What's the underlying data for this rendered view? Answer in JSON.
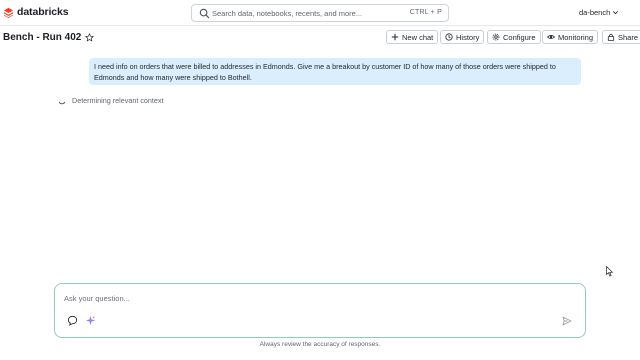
{
  "header": {
    "logo_text": "databricks",
    "logo_color": "#ff3621",
    "search": {
      "placeholder": "Search data, notebooks, recents, and more...",
      "shortcut": "CTRL + P",
      "icon": "search-icon"
    },
    "workspace": "da-bench",
    "workspace_icon": "chevron-down-icon"
  },
  "page": {
    "title": "Bench - Run 402",
    "title_icon": "star-icon"
  },
  "toolbar": {
    "new_chat": "New chat",
    "history": "History",
    "configure": "Configure",
    "monitoring": "Monitoring",
    "share": "Share"
  },
  "conversation": {
    "user_message": "I need info on orders that were billed to addresses in Edmonds. Give me a breakout by customer ID of how many of those orders were shipped to Edmonds and how many were shipped to Bothell.",
    "user_bubble_color": "#dbeefe",
    "status_text": "Determining relevant context",
    "status_icon": "spinner-icon"
  },
  "composer": {
    "placeholder": "Ask your question...",
    "border_color": "#8fcfb6",
    "icons": [
      "comment-icon",
      "sparkle-icon",
      "send-icon"
    ]
  },
  "footer": {
    "disclaimer": "Always review the accuracy of responses."
  }
}
